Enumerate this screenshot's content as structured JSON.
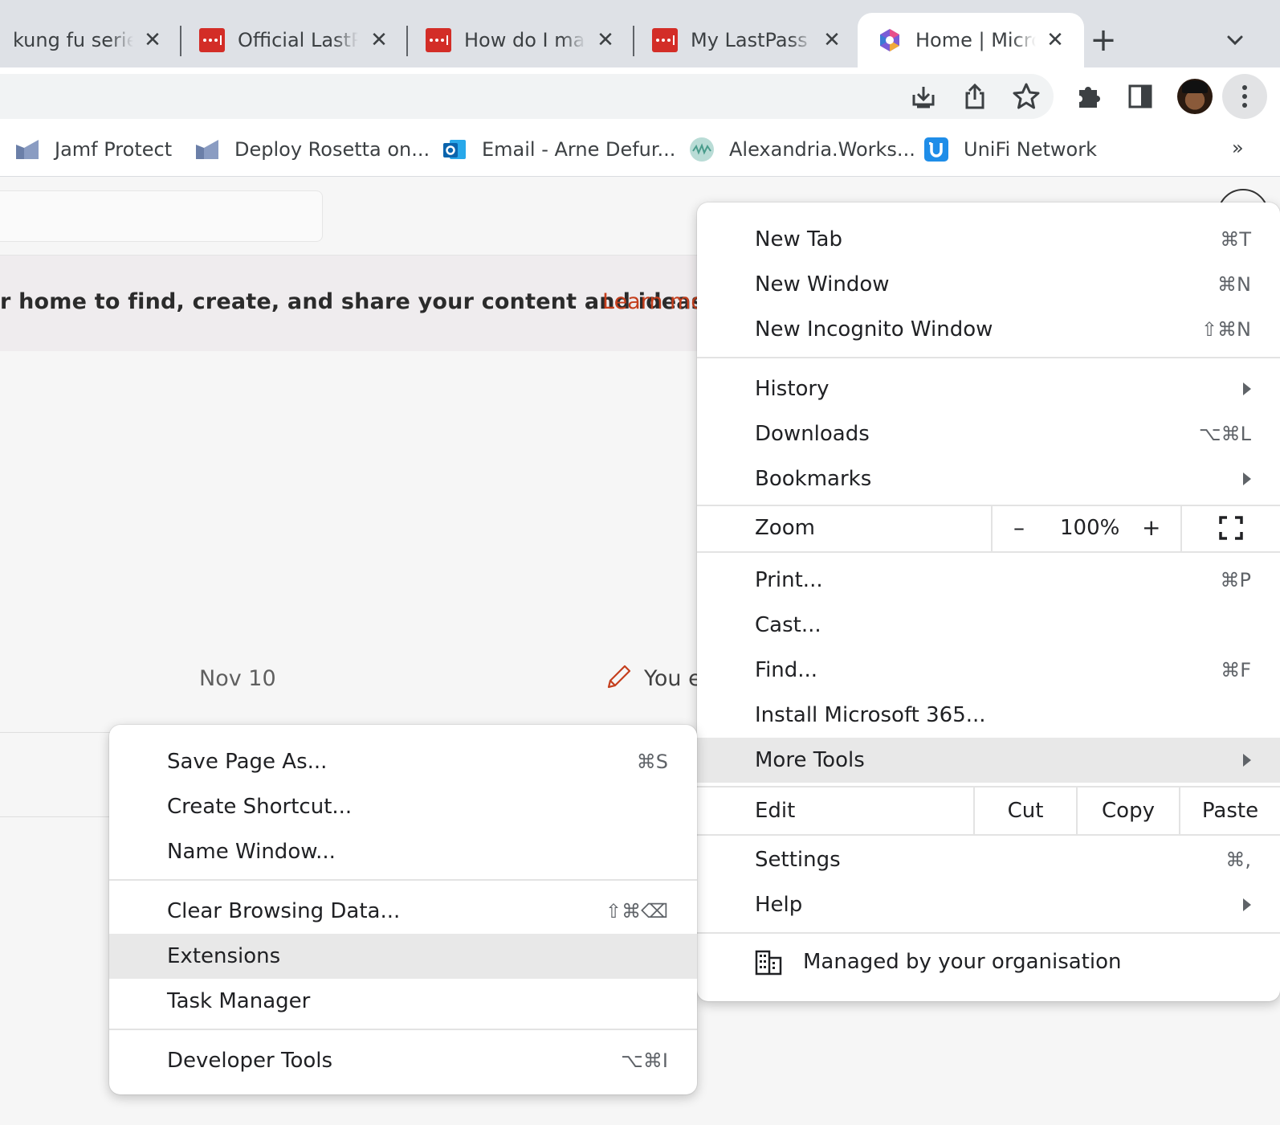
{
  "tabs": [
    {
      "title": "kung fu series",
      "icon": "none",
      "active": false
    },
    {
      "title": "Official LastPass",
      "icon": "lastpass-icon",
      "active": false
    },
    {
      "title": "How do I man",
      "icon": "lastpass-icon",
      "active": false
    },
    {
      "title": "My LastPass V",
      "icon": "lastpass-icon",
      "active": false
    },
    {
      "title": "Home | Micro",
      "icon": "microsoft365-icon",
      "active": true
    }
  ],
  "tab_close_glyph": "✕",
  "new_tab_glyph": "+",
  "bookmarks": [
    {
      "label": "Jamf Protect",
      "icon": "jamf-icon"
    },
    {
      "label": "Deploy Rosetta on...",
      "icon": "jamf-icon"
    },
    {
      "label": "Email - Arne Defur...",
      "icon": "outlook-icon"
    },
    {
      "label": "Alexandria.Works...",
      "icon": "alexandria-icon"
    },
    {
      "label": "UniFi Network",
      "icon": "unifi-icon"
    }
  ],
  "bookmarks_overflow": "»",
  "page": {
    "banner_text": "r home to find, create, and share your content and ideas.",
    "banner_link": "Learn mo",
    "date": "Nov 10",
    "activity": "You e"
  },
  "main_menu": {
    "group1": [
      {
        "label": "New Tab",
        "shortcut": "⌘T"
      },
      {
        "label": "New Window",
        "shortcut": "⌘N"
      },
      {
        "label": "New Incognito Window",
        "shortcut": "⇧⌘N"
      }
    ],
    "group2": [
      {
        "label": "History",
        "shortcut": "",
        "submenu": true
      },
      {
        "label": "Downloads",
        "shortcut": "⌥⌘L",
        "submenu": false
      },
      {
        "label": "Bookmarks",
        "shortcut": "",
        "submenu": true
      }
    ],
    "zoom": {
      "label": "Zoom",
      "minus": "–",
      "value": "100%",
      "plus": "+"
    },
    "group3": [
      {
        "label": "Print...",
        "shortcut": "⌘P"
      },
      {
        "label": "Cast...",
        "shortcut": ""
      },
      {
        "label": "Find...",
        "shortcut": "⌘F"
      },
      {
        "label": "Install Microsoft 365...",
        "shortcut": ""
      },
      {
        "label": "More Tools",
        "shortcut": "",
        "submenu": true,
        "highlighted": true
      }
    ],
    "edit": {
      "label": "Edit",
      "cut": "Cut",
      "copy": "Copy",
      "paste": "Paste"
    },
    "group4": [
      {
        "label": "Settings",
        "shortcut": "⌘,"
      },
      {
        "label": "Help",
        "shortcut": "",
        "submenu": true
      }
    ],
    "managed": "Managed by your organisation"
  },
  "more_tools_menu": {
    "group1": [
      {
        "label": "Save Page As...",
        "shortcut": "⌘S"
      },
      {
        "label": "Create Shortcut...",
        "shortcut": ""
      },
      {
        "label": "Name Window...",
        "shortcut": ""
      }
    ],
    "group2": [
      {
        "label": "Clear Browsing Data...",
        "shortcut": "⇧⌘⌫"
      },
      {
        "label": "Extensions",
        "shortcut": "",
        "highlighted": true
      },
      {
        "label": "Task Manager",
        "shortcut": ""
      }
    ],
    "group3": [
      {
        "label": "Developer Tools",
        "shortcut": "⌥⌘I"
      }
    ]
  },
  "colors": {
    "tab_strip": "#dee1e6",
    "lastpass_red": "#d32d27",
    "banner_link": "#c43e1c",
    "menu_highlight": "#e8e8e8"
  }
}
